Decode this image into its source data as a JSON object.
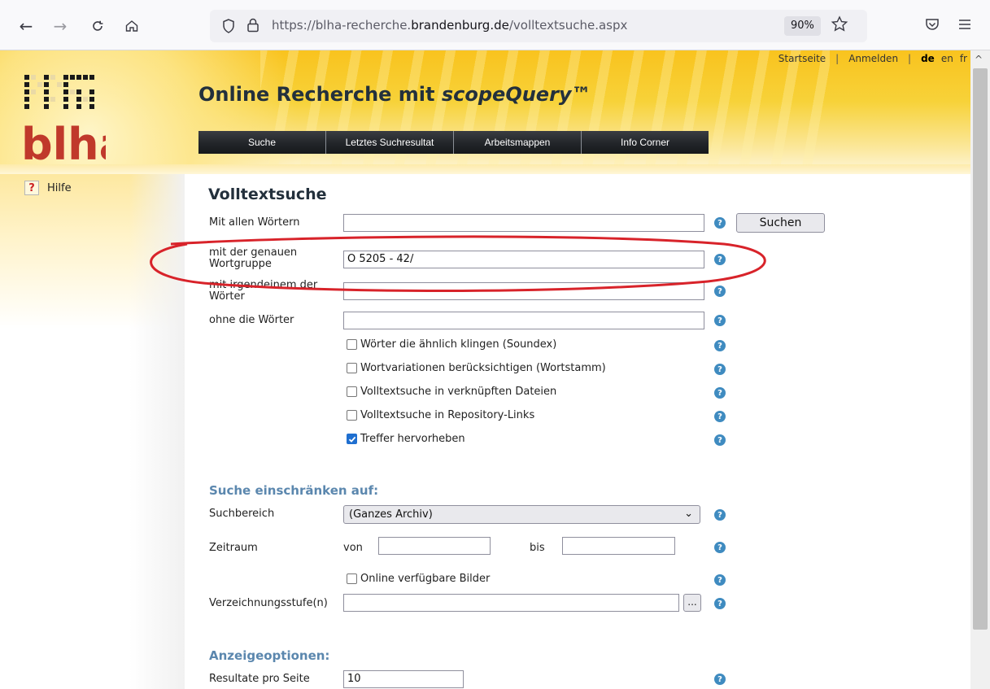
{
  "browser": {
    "url_prefix": "https://blha-recherche.",
    "url_domain": "brandenburg.de",
    "url_path": "/volltextsuche.aspx",
    "zoom": "90%"
  },
  "header": {
    "logo_text": "blha",
    "title_prefix": "Online Recherche mit ",
    "title_product": "scopeQuery™",
    "top_links": {
      "startseite": "Startseite",
      "sep": "|",
      "anmelden": "Anmelden",
      "lang_de": "de",
      "lang_en": "en",
      "lang_fr": "fr"
    },
    "nav": [
      "Suche",
      "Letztes Suchresultat",
      "Arbeitsmappen",
      "Info Corner"
    ]
  },
  "sidebar": {
    "help_label": "Hilfe"
  },
  "form": {
    "heading": "Volltextsuche",
    "fields": {
      "all_words_label": "Mit allen Wörtern",
      "all_words_value": "",
      "exact_phrase_label_1": "mit der genauen",
      "exact_phrase_label_2": "Wortgruppe",
      "exact_phrase_value": "O 5205 - 42/",
      "any_words_label_1": "mit irgendeinem der",
      "any_words_label_2": "Wörter",
      "any_words_value": "",
      "without_words_label": "ohne die Wörter",
      "without_words_value": ""
    },
    "search_button": "Suchen",
    "options": [
      {
        "label": "Wörter die ähnlich klingen (Soundex)",
        "checked": false
      },
      {
        "label": "Wortvariationen berücksichtigen (Wortstamm)",
        "checked": false
      },
      {
        "label": "Volltextsuche in verknüpften Dateien",
        "checked": false
      },
      {
        "label": "Volltextsuche in Repository-Links",
        "checked": false
      },
      {
        "label": "Treffer hervorheben",
        "checked": true
      }
    ],
    "restrict": {
      "heading": "Suche einschränken auf:",
      "suchbereich_label": "Suchbereich",
      "suchbereich_value": "(Ganzes Archiv)",
      "zeitraum_label": "Zeitraum",
      "von_label": "von",
      "bis_label": "bis",
      "online_images_label": "Online verfügbare Bilder",
      "online_images_checked": false,
      "level_label": "Verzeichnungsstufe(n)",
      "level_button": "..."
    },
    "display": {
      "heading": "Anzeigeoptionen:",
      "per_page_label": "Resultate pro Seite",
      "per_page_value": "10"
    }
  },
  "icons": {
    "help_marker": "?",
    "info": "?"
  },
  "colors": {
    "header_yellow": "#f9c31e",
    "nav_dark": "#24272b",
    "section_blue": "#5b87ae",
    "info_icon": "#3f8bc0",
    "annotation_red": "#d8232a"
  }
}
